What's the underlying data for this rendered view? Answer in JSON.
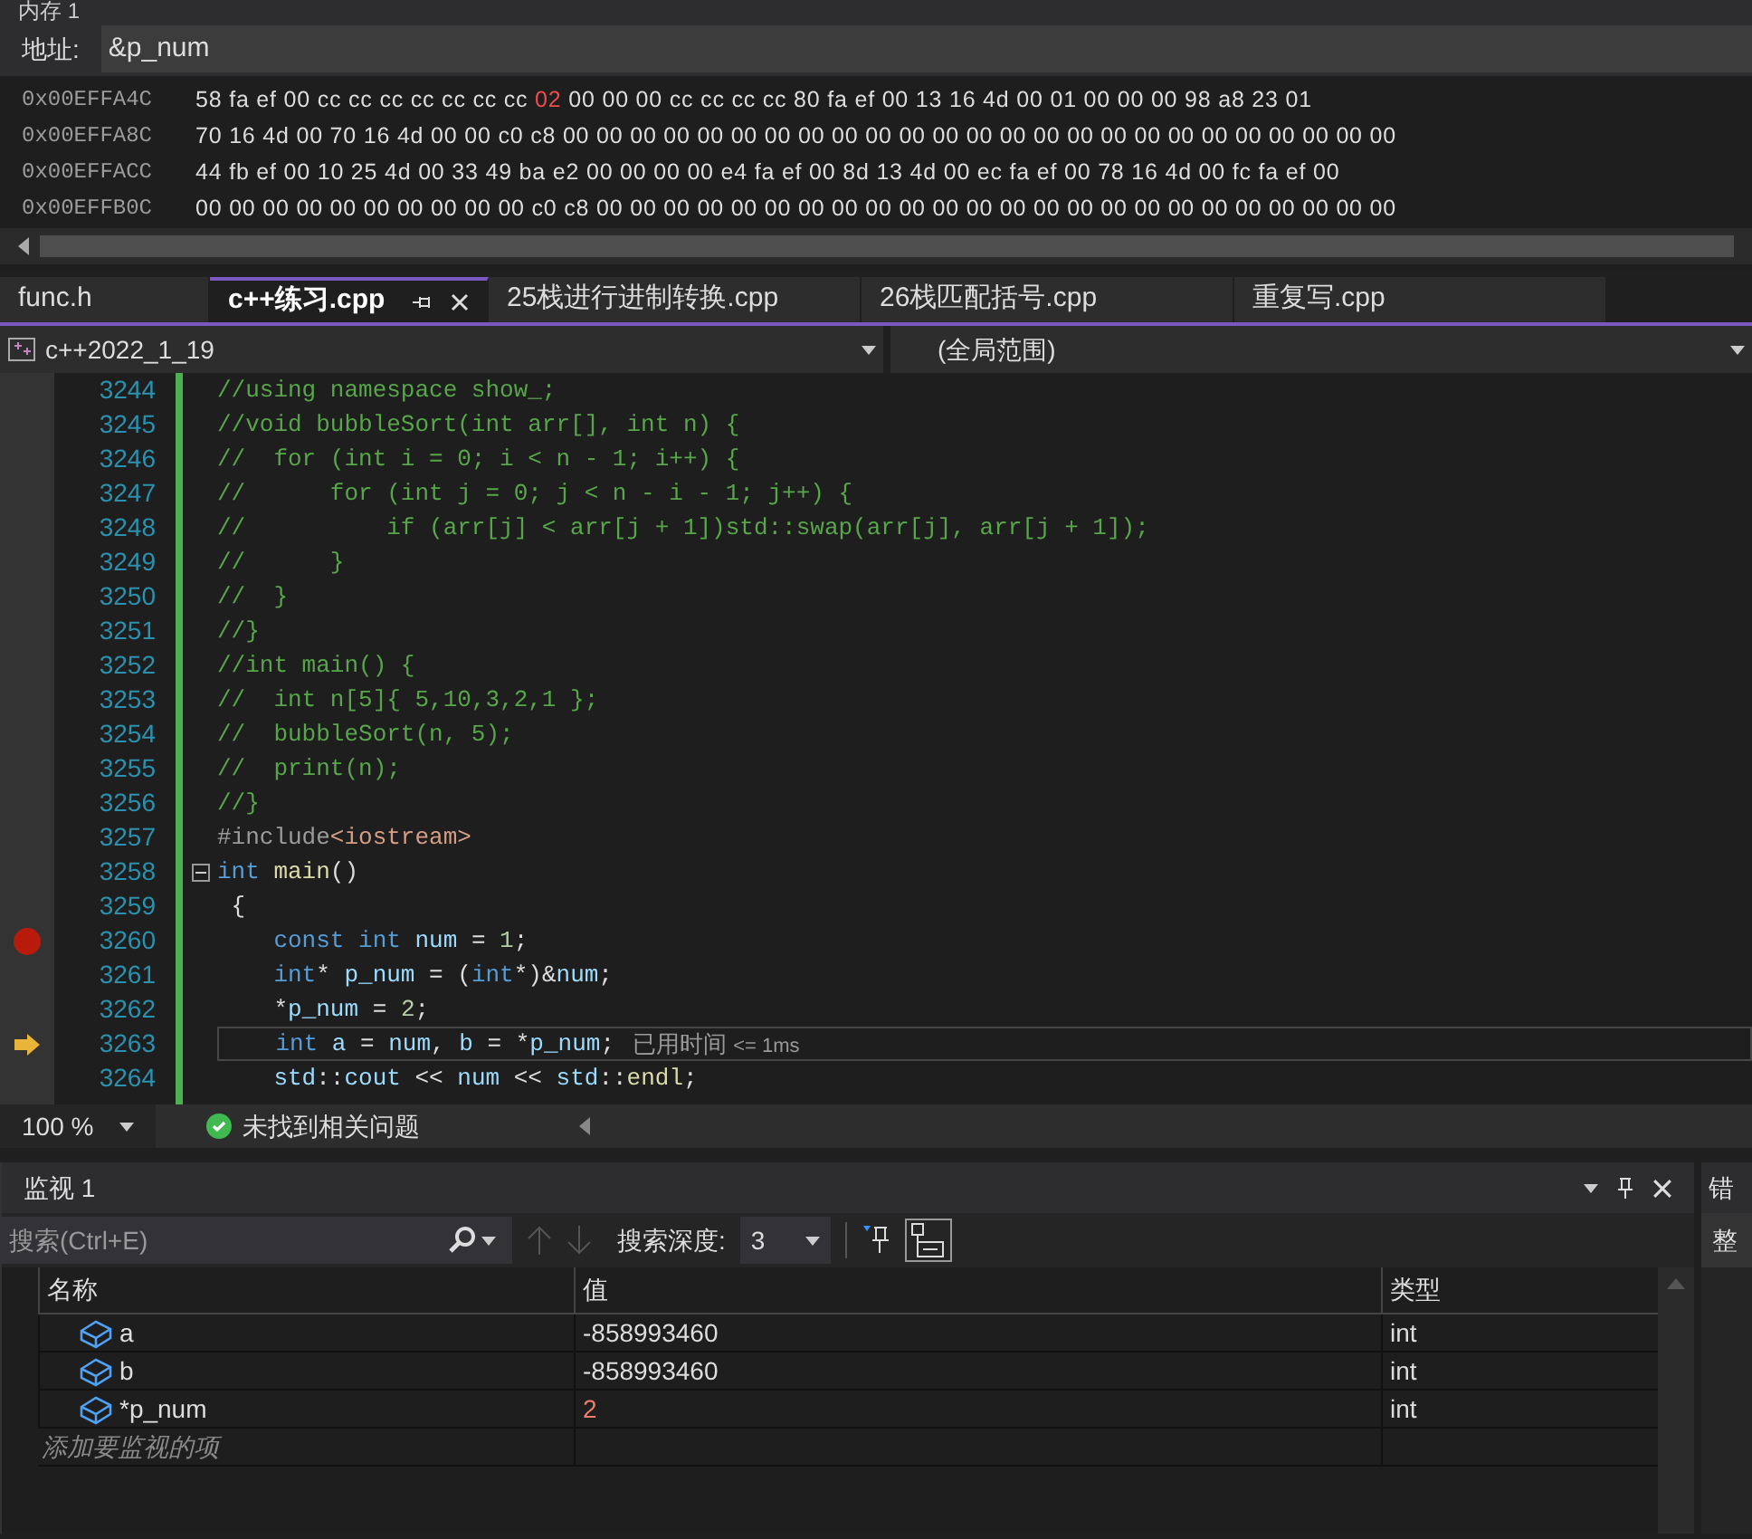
{
  "memory": {
    "title": "内存 1",
    "address_label": "地址:",
    "address": "&p_num",
    "rows": [
      {
        "address": "0x00EFFA4C",
        "bytes": [
          {
            "text": "58 fa ef 00 cc cc cc cc cc cc cc",
            "changed": false
          },
          {
            "text": "02",
            "changed": true
          },
          {
            "text": "00 00 00 cc cc cc cc 80 fa ef 00 13 16 4d 00 01 00 00 00 98 a8 23 01",
            "changed": false
          }
        ]
      },
      {
        "address": "0x00EFFA8C",
        "bytes": [
          {
            "text": "70 16 4d 00 70 16 4d 00 00 c0 c8 00 00 00 00 00 00 00 00 00 00 00 00 00 00 00 00 00 00 00 00 00 00 00 00 00",
            "changed": false
          }
        ]
      },
      {
        "address": "0x00EFFACC",
        "bytes": [
          {
            "text": "44 fb ef 00 10 25 4d 00 33 49 ba e2 00 00 00 00 e4 fa ef 00 8d 13 4d 00 ec fa ef 00 78 16 4d 00 fc fa ef 00",
            "changed": false
          }
        ]
      },
      {
        "address": "0x00EFFB0C",
        "bytes": [
          {
            "text": "00 00 00 00 00 00 00 00 00 00 c0 c8 00 00 00 00 00 00 00 00 00 00 00 00 00 00 00 00 00 00 00 00 00 00 00 00",
            "changed": false
          }
        ]
      }
    ]
  },
  "tabs": [
    {
      "label": "func.h",
      "selected": false
    },
    {
      "label": "c++练习.cpp",
      "selected": true
    },
    {
      "label": "25栈进行进制转换.cpp",
      "selected": false
    },
    {
      "label": "26栈匹配括号.cpp",
      "selected": false
    },
    {
      "label": "重复写.cpp",
      "selected": false
    }
  ],
  "nav": {
    "project": "c++2022_1_19",
    "scope": "(全局范围)"
  },
  "code_lines": [
    {
      "number": "3244",
      "breakpoint": false,
      "current": false,
      "fold": false,
      "segments": [
        {
          "kind": "comment",
          "text": "//using namespace show_;"
        }
      ]
    },
    {
      "number": "3245",
      "breakpoint": false,
      "current": false,
      "fold": false,
      "segments": [
        {
          "kind": "comment",
          "text": "//void bubbleSort(int arr[], int n) {"
        }
      ]
    },
    {
      "number": "3246",
      "breakpoint": false,
      "current": false,
      "fold": false,
      "segments": [
        {
          "kind": "comment",
          "text": "//  for (int i = 0; i < n - 1; i++) {"
        }
      ]
    },
    {
      "number": "3247",
      "breakpoint": false,
      "current": false,
      "fold": false,
      "segments": [
        {
          "kind": "comment",
          "text": "//      for (int j = 0; j < n - i - 1; j++) {"
        }
      ]
    },
    {
      "number": "3248",
      "breakpoint": false,
      "current": false,
      "fold": false,
      "segments": [
        {
          "kind": "comment",
          "text": "//          if (arr[j] < arr[j + 1])std::swap(arr[j], arr[j + 1]);"
        }
      ]
    },
    {
      "number": "3249",
      "breakpoint": false,
      "current": false,
      "fold": false,
      "segments": [
        {
          "kind": "comment",
          "text": "//      }"
        }
      ]
    },
    {
      "number": "3250",
      "breakpoint": false,
      "current": false,
      "fold": false,
      "segments": [
        {
          "kind": "comment",
          "text": "//  }"
        }
      ]
    },
    {
      "number": "3251",
      "breakpoint": false,
      "current": false,
      "fold": false,
      "segments": [
        {
          "kind": "comment",
          "text": "//}"
        }
      ]
    },
    {
      "number": "3252",
      "breakpoint": false,
      "current": false,
      "fold": false,
      "segments": [
        {
          "kind": "comment",
          "text": "//int main() {"
        }
      ]
    },
    {
      "number": "3253",
      "breakpoint": false,
      "current": false,
      "fold": false,
      "segments": [
        {
          "kind": "comment",
          "text": "//  int n[5]{ 5,10,3,2,1 };"
        }
      ]
    },
    {
      "number": "3254",
      "breakpoint": false,
      "current": false,
      "fold": false,
      "segments": [
        {
          "kind": "comment",
          "text": "//  bubbleSort(n, 5);"
        }
      ]
    },
    {
      "number": "3255",
      "breakpoint": false,
      "current": false,
      "fold": false,
      "segments": [
        {
          "kind": "comment",
          "text": "//  print(n);"
        }
      ]
    },
    {
      "number": "3256",
      "breakpoint": false,
      "current": false,
      "fold": false,
      "segments": [
        {
          "kind": "comment",
          "text": "//}"
        }
      ]
    },
    {
      "number": "3257",
      "breakpoint": false,
      "current": false,
      "fold": false,
      "segments": [
        {
          "kind": "preproc",
          "text": "#include"
        },
        {
          "kind": "string",
          "text": "<iostream>"
        }
      ]
    },
    {
      "number": "3258",
      "breakpoint": false,
      "current": false,
      "fold": true,
      "segments": [
        {
          "kind": "keyword",
          "text": "int"
        },
        {
          "kind": "function",
          "text": " main"
        },
        {
          "kind": "plain",
          "text": "()"
        }
      ]
    },
    {
      "number": "3259",
      "breakpoint": false,
      "current": false,
      "fold": false,
      "segments": [
        {
          "kind": "plain",
          "text": " {"
        }
      ]
    },
    {
      "number": "3260",
      "breakpoint": true,
      "current": false,
      "fold": false,
      "segments": [
        {
          "kind": "keyword",
          "text": "    const int"
        },
        {
          "kind": "variable",
          "text": " num"
        },
        {
          "kind": "plain",
          "text": " = "
        },
        {
          "kind": "number",
          "text": "1"
        },
        {
          "kind": "plain",
          "text": ";"
        }
      ]
    },
    {
      "number": "3261",
      "breakpoint": false,
      "current": false,
      "fold": false,
      "segments": [
        {
          "kind": "keyword",
          "text": "    int"
        },
        {
          "kind": "plain",
          "text": "* "
        },
        {
          "kind": "variable",
          "text": "p_num"
        },
        {
          "kind": "plain",
          "text": " = ("
        },
        {
          "kind": "keyword",
          "text": "int"
        },
        {
          "kind": "plain",
          "text": "*)&"
        },
        {
          "kind": "variable",
          "text": "num"
        },
        {
          "kind": "plain",
          "text": ";"
        }
      ]
    },
    {
      "number": "3262",
      "breakpoint": false,
      "current": false,
      "fold": false,
      "segments": [
        {
          "kind": "plain",
          "text": "    *"
        },
        {
          "kind": "variable",
          "text": "p_num"
        },
        {
          "kind": "plain",
          "text": " = "
        },
        {
          "kind": "number",
          "text": "2"
        },
        {
          "kind": "plain",
          "text": ";"
        }
      ]
    },
    {
      "number": "3263",
      "breakpoint": false,
      "current": true,
      "fold": false,
      "segments": [
        {
          "kind": "keyword",
          "text": "    int"
        },
        {
          "kind": "variable",
          "text": " a"
        },
        {
          "kind": "plain",
          "text": " = "
        },
        {
          "kind": "variable",
          "text": "num"
        },
        {
          "kind": "plain",
          "text": ", "
        },
        {
          "kind": "variable",
          "text": "b"
        },
        {
          "kind": "plain",
          "text": " = *"
        },
        {
          "kind": "variable",
          "text": "p_num"
        },
        {
          "kind": "plain",
          "text": ";"
        }
      ],
      "hint": {
        "label": "已用时间",
        "value": "<= 1ms"
      }
    },
    {
      "number": "3264",
      "breakpoint": false,
      "current": false,
      "fold": false,
      "segments": [
        {
          "kind": "variable",
          "text": "    std"
        },
        {
          "kind": "plain",
          "text": "::"
        },
        {
          "kind": "variable",
          "text": "cout"
        },
        {
          "kind": "plain",
          "text": " << "
        },
        {
          "kind": "variable",
          "text": "num"
        },
        {
          "kind": "plain",
          "text": " << "
        },
        {
          "kind": "variable",
          "text": "std"
        },
        {
          "kind": "plain",
          "text": "::"
        },
        {
          "kind": "function",
          "text": "endl"
        },
        {
          "kind": "plain",
          "text": ";"
        }
      ]
    }
  ],
  "status_bar": {
    "zoom": "100 %",
    "issues": "未找到相关问题"
  },
  "watch": {
    "title": "监视 1",
    "search": {
      "placeholder": "搜索(Ctrl+E)"
    },
    "depth_label": "搜索深度:",
    "depth": "3",
    "columns": [
      "名称",
      "值",
      "类型"
    ],
    "rows": [
      {
        "name": "a",
        "value": "-858993460",
        "type": "int",
        "changed": false
      },
      {
        "name": "b",
        "value": "-858993460",
        "type": "int",
        "changed": false
      },
      {
        "name": "*p_num",
        "value": "2",
        "type": "int",
        "changed": true
      }
    ],
    "add_placeholder": "添加要监视的项"
  },
  "side_panel": {
    "title": "错",
    "item": "整"
  }
}
